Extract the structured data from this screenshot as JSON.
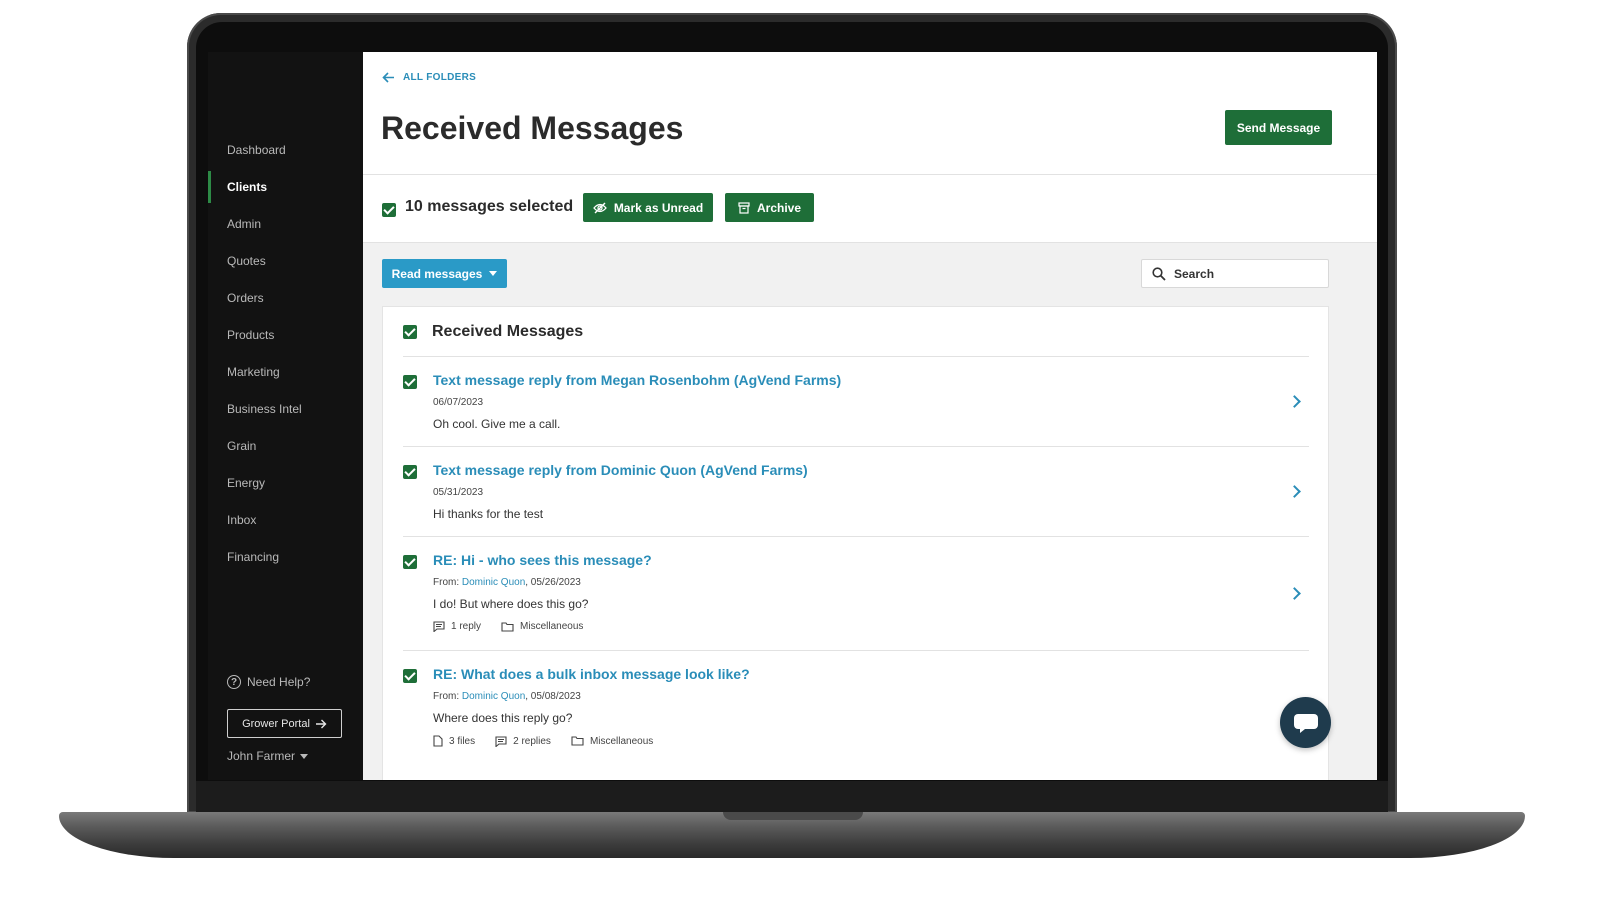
{
  "sidebar": {
    "items": [
      {
        "label": "Dashboard",
        "active": false
      },
      {
        "label": "Clients",
        "active": true
      },
      {
        "label": "Admin",
        "active": false
      },
      {
        "label": "Quotes",
        "active": false
      },
      {
        "label": "Orders",
        "active": false
      },
      {
        "label": "Products",
        "active": false
      },
      {
        "label": "Marketing",
        "active": false
      },
      {
        "label": "Business Intel",
        "active": false
      },
      {
        "label": "Grain",
        "active": false
      },
      {
        "label": "Energy",
        "active": false
      },
      {
        "label": "Inbox",
        "active": false
      },
      {
        "label": "Financing",
        "active": false
      }
    ],
    "help_label": "Need Help?",
    "grower_portal_label": "Grower Portal",
    "user_name": "John Farmer"
  },
  "header": {
    "back_label": "ALL FOLDERS",
    "title": "Received Messages",
    "send_label": "Send Message"
  },
  "selection": {
    "count_label": "10 messages selected",
    "mark_unread_label": "Mark as Unread",
    "archive_label": "Archive"
  },
  "filter": {
    "label": "Read messages"
  },
  "search": {
    "placeholder": "Search"
  },
  "panel": {
    "title": "Received Messages"
  },
  "messages": [
    {
      "title": "Text message reply from Megan Rosenbohm (AgVend Farms)",
      "date": "06/07/2023",
      "body": "Oh cool. Give me a call."
    },
    {
      "title": "Text message reply from Dominic Quon (AgVend Farms)",
      "date": "05/31/2023",
      "body": "Hi thanks for the test"
    },
    {
      "title": "RE: Hi - who sees this message?",
      "from_prefix": "From: ",
      "from_name": "Dominic Quon",
      "date": ", 05/26/2023",
      "body": "I do! But where does this go?",
      "replies": "1 reply",
      "folder": "Miscellaneous"
    },
    {
      "title": "RE: What does a bulk inbox message look like?",
      "from_prefix": "From: ",
      "from_name": "Dominic Quon",
      "date": ", 05/08/2023",
      "body": "Where does this reply go?",
      "files": "3 files",
      "replies": "2 replies",
      "folder": "Miscellaneous"
    }
  ],
  "colors": {
    "primary_green": "#1e6e38",
    "link_blue": "#2a8db8",
    "filter_blue": "#2a9ac7",
    "sidebar_bg": "#121212",
    "chat_fab": "#1f3b4d"
  }
}
